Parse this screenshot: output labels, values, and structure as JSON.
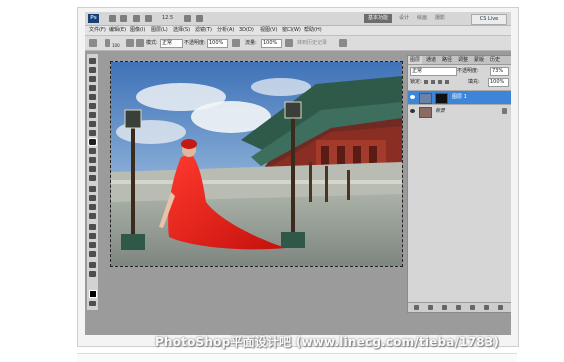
{
  "app": {
    "logo": "Ps",
    "zoom": "12.5",
    "workspaces": [
      "基本功能",
      "设计",
      "绘画",
      "摄影"
    ],
    "cs_live": "CS Live"
  },
  "menu": [
    "文件(F)",
    "编辑(E)",
    "图像(I)",
    "图层(L)",
    "选择(S)",
    "滤镜(T)",
    "分析(A)",
    "3D(D)",
    "视图(V)",
    "窗口(W)",
    "帮助(H)"
  ],
  "options": {
    "brush_size": "100",
    "mode_label": "模式:",
    "mode_value": "正常",
    "opacity_label": "不透明度:",
    "opacity_value": "100%",
    "flow_label": "流量:",
    "flow_value": "100%",
    "extra_label": "抹到历史记录"
  },
  "layers_panel": {
    "tabs": [
      "图层",
      "通道",
      "路径",
      "调整",
      "蒙版",
      "历史"
    ],
    "blend_mode": "正常",
    "opacity_label": "不透明度:",
    "opacity_value": "73%",
    "lock_label": "锁定:",
    "fill_label": "填充:",
    "fill_value": "100%",
    "layers": [
      {
        "name": "图层 1",
        "active": true
      },
      {
        "name": "背景",
        "active": false
      }
    ]
  },
  "watermark": "PhotoShop平面设计吧  (www.linecg.com/tieba/1783)",
  "colors": {
    "accent": "#3d85d8",
    "chrome": "#d6d6d6",
    "workspace_bg": "#9b9b9b"
  }
}
